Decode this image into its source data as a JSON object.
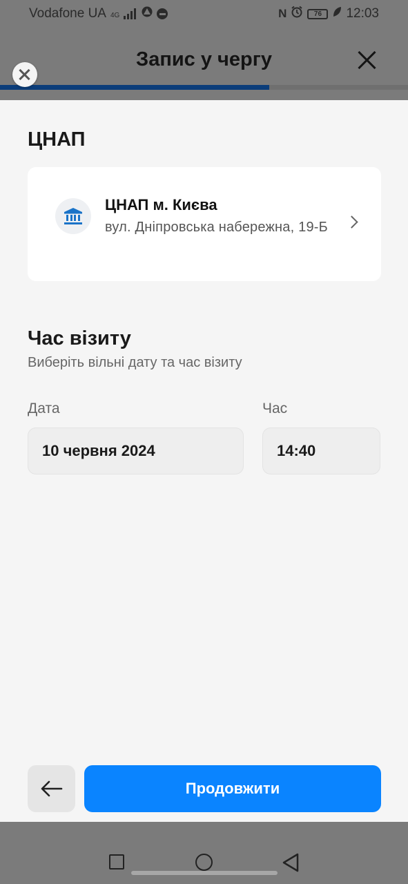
{
  "status_bar": {
    "carrier": "Vodafone UA",
    "network": "4G",
    "battery": "76",
    "time": "12:03"
  },
  "header": {
    "title": "Запис у чергу",
    "progress_fraction": 0.66
  },
  "cnap_section": {
    "title": "ЦНАП",
    "card": {
      "name": "ЦНАП м. Києва",
      "address": "вул. Дніпровська набережна, 19-Б",
      "icon": "government-building-icon"
    }
  },
  "visit_section": {
    "title": "Час візиту",
    "subtitle": "Виберіть вільні дату та час візиту",
    "date_label": "Дата",
    "date_value": "10 червня 2024",
    "time_label": "Час",
    "time_value": "14:40"
  },
  "footer": {
    "continue_label": "Продовжити"
  },
  "colors": {
    "accent": "#0a84ff",
    "progress": "#0b3d7a",
    "icon": "#1a73c8"
  }
}
